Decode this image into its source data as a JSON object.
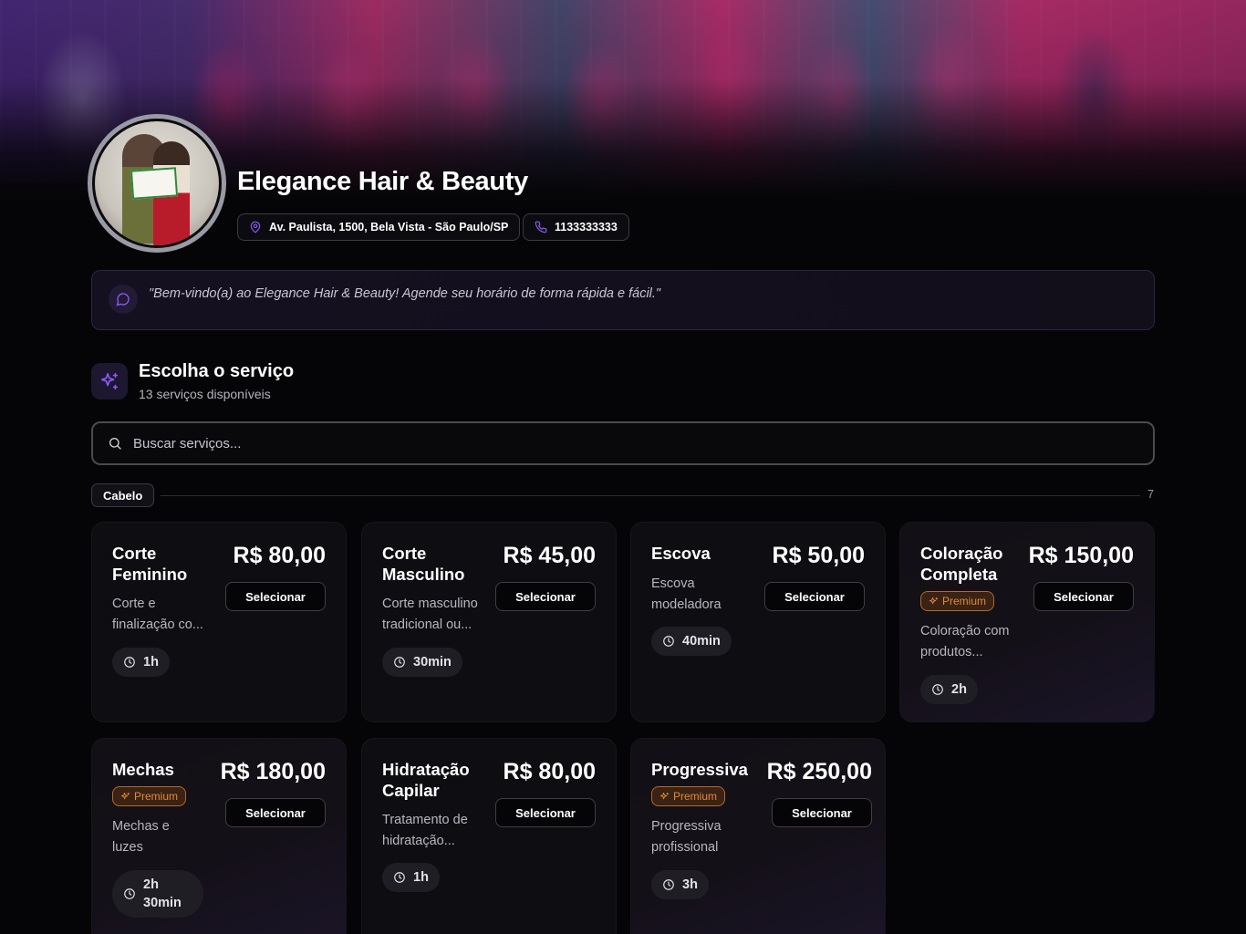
{
  "salon": {
    "name": "Elegance Hair & Beauty",
    "address": "Av. Paulista, 1500, Bela Vista - São Paulo/SP",
    "phone": "1133333333",
    "welcome": "\"Bem-vindo(a) ao Elegance Hair & Beauty! Agende seu horário de forma rápida e fácil.\""
  },
  "section": {
    "title": "Escolha o serviço",
    "subtitle": "13 serviços disponíveis"
  },
  "search": {
    "placeholder": "Buscar serviços..."
  },
  "category": {
    "name": "Cabelo",
    "count": "7"
  },
  "services": [
    {
      "name": "Corte Feminino",
      "price": "R$ 80,00",
      "description": "Corte e finalização co...",
      "duration": "1h",
      "premium": false,
      "select_label": "Selecionar"
    },
    {
      "name": "Corte Masculino",
      "price": "R$ 45,00",
      "description": "Corte masculino tradicional ou...",
      "duration": "30min",
      "premium": false,
      "select_label": "Selecionar"
    },
    {
      "name": "Escova",
      "price": "R$ 50,00",
      "description": "Escova modeladora",
      "duration": "40min",
      "premium": false,
      "select_label": "Selecionar"
    },
    {
      "name": "Coloração Completa",
      "price": "R$ 150,00",
      "description": "Coloração com produtos...",
      "duration": "2h",
      "premium": true,
      "badge": "Premium",
      "select_label": "Selecionar"
    },
    {
      "name": "Mechas",
      "price": "R$ 180,00",
      "description": "Mechas e luzes",
      "duration": "2h 30min",
      "premium": true,
      "badge": "Premium",
      "select_label": "Selecionar"
    },
    {
      "name": "Hidratação Capilar",
      "price": "R$ 80,00",
      "description": "Tratamento de hidratação...",
      "duration": "1h",
      "premium": false,
      "select_label": "Selecionar"
    },
    {
      "name": "Progressiva",
      "price": "R$ 250,00",
      "description": "Progressiva profissional",
      "duration": "3h",
      "premium": true,
      "badge": "Premium",
      "select_label": "Selecionar"
    }
  ],
  "colors": {
    "accent": "#8b5cf6",
    "premium": "#e08a3c",
    "background": "#050507"
  },
  "icons": {
    "address": "map-pin-icon",
    "phone": "phone-icon",
    "welcome": "message-circle-icon",
    "section": "sparkles-icon",
    "search": "search-icon",
    "duration": "clock-icon",
    "premium": "sparkles-icon"
  }
}
